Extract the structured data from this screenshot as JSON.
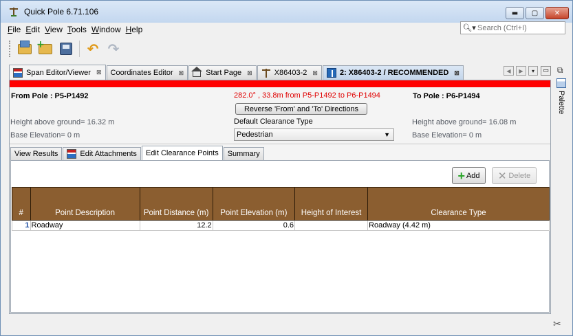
{
  "window": {
    "title": "Quick Pole 6.71.106",
    "controls": {
      "minimize": "▬",
      "maximize": "▢",
      "close": "✕"
    }
  },
  "menu": {
    "items": [
      {
        "label": "File",
        "mnemonic": "F",
        "rest": "ile"
      },
      {
        "label": "Edit",
        "mnemonic": "E",
        "rest": "dit"
      },
      {
        "label": "View",
        "mnemonic": "V",
        "rest": "iew"
      },
      {
        "label": "Tools",
        "mnemonic": "T",
        "rest": "ools"
      },
      {
        "label": "Window",
        "mnemonic": "W",
        "rest": "indow"
      },
      {
        "label": "Help",
        "mnemonic": "H",
        "rest": "elp"
      }
    ]
  },
  "search": {
    "placeholder": "Search (Ctrl+I)",
    "icon": "magnifier-icon"
  },
  "toolbar": {
    "buttons": [
      "open-project",
      "new-folder",
      "save-all",
      "undo",
      "redo"
    ],
    "undo_glyph": "↶",
    "redo_glyph": "↷"
  },
  "editor_tabs": [
    {
      "label": "Span Editor/Viewer",
      "close": "⊠",
      "icon": "span-icon",
      "active": true
    },
    {
      "label": "Coordinates Editor",
      "close": "⊠"
    },
    {
      "label": "Start Page",
      "close": "⊠",
      "icon": "house-icon"
    },
    {
      "label": "X86403-2",
      "close": "⊠",
      "icon": "pole-icon"
    },
    {
      "label": "2: X86403-2 / RECOMMENDED",
      "close": "⊠",
      "icon": "recommended-icon"
    }
  ],
  "tab_nav": {
    "left": "◀",
    "right": "▶",
    "dropdown": "▾",
    "maximize": "▭",
    "restore": "⧉"
  },
  "span": {
    "from_pole": "From Pole : P5-P1492",
    "to_pole": "To Pole : P6-P1494",
    "span_info": "282.0° , 33.8m from P5-P1492 to P6-P1494",
    "reverse_label": "Reverse 'From' and 'To' Directions",
    "from_height": "Height above ground= 16.32 m",
    "from_base": "Base Elevation= 0 m",
    "to_height": "Height above ground= 16.08 m",
    "to_base": "Base Elevation= 0 m",
    "default_clearance_label": "Default Clearance Type",
    "default_clearance_value": "Pedestrian",
    "select_arrow": "▼"
  },
  "subtabs": [
    {
      "label": "View Results"
    },
    {
      "label": "Edit Attachments",
      "icon": "attachments-icon"
    },
    {
      "label": "Edit Clearance Points",
      "active": true
    },
    {
      "label": "Summary"
    }
  ],
  "actions": {
    "add_label": "Add",
    "add_glyph": "+",
    "delete_label": "Delete",
    "delete_glyph": "✕"
  },
  "table": {
    "columns": [
      "#",
      "Point Description",
      "Point Distance (m)",
      "Point Elevation (m)",
      "Height of Interest",
      "Clearance Type"
    ],
    "rows": [
      {
        "num": "1",
        "description": "Roadway",
        "distance": "12.2",
        "elevation": "0.6",
        "height": "",
        "clearance": "Roadway (4.42 m)"
      }
    ]
  },
  "palette": {
    "label": "Palette"
  },
  "status": {
    "icon": "wrench-icon",
    "glyph": "✂"
  },
  "colors": {
    "header_brown": "#8b5e30",
    "red_bar": "#ff0000",
    "span_info_red": "#e00000",
    "add_green": "#2aa52a"
  }
}
